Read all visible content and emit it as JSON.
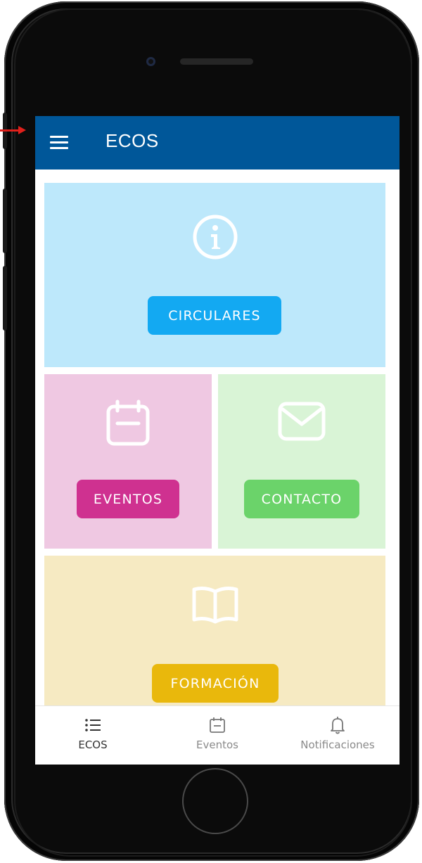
{
  "app": {
    "title": "ECOS"
  },
  "tiles": {
    "circulares": {
      "label": "CIRCULARES",
      "icon": "info-icon",
      "bg": "#bde8fb",
      "button_color": "#13a9f2"
    },
    "eventos": {
      "label": "EVENTOS",
      "icon": "calendar-icon",
      "bg": "#efc8e2",
      "button_color": "#cf3190"
    },
    "contacto": {
      "label": "CONTACTO",
      "icon": "mail-icon",
      "bg": "#d9f4d6",
      "button_color": "#6bd36a"
    },
    "formacion": {
      "label": "FORMACIÓN",
      "icon": "book-icon",
      "bg": "#f6eac2",
      "button_color": "#e9b80c"
    }
  },
  "bottom_nav": {
    "items": [
      {
        "label": "ECOS",
        "icon": "list-icon",
        "active": true
      },
      {
        "label": "Eventos",
        "icon": "calendar-icon",
        "active": false
      },
      {
        "label": "Notificaciones",
        "icon": "bell-icon",
        "active": false
      }
    ]
  },
  "colors": {
    "appbar": "#005799",
    "annotation_arrow": "#e0201b"
  }
}
